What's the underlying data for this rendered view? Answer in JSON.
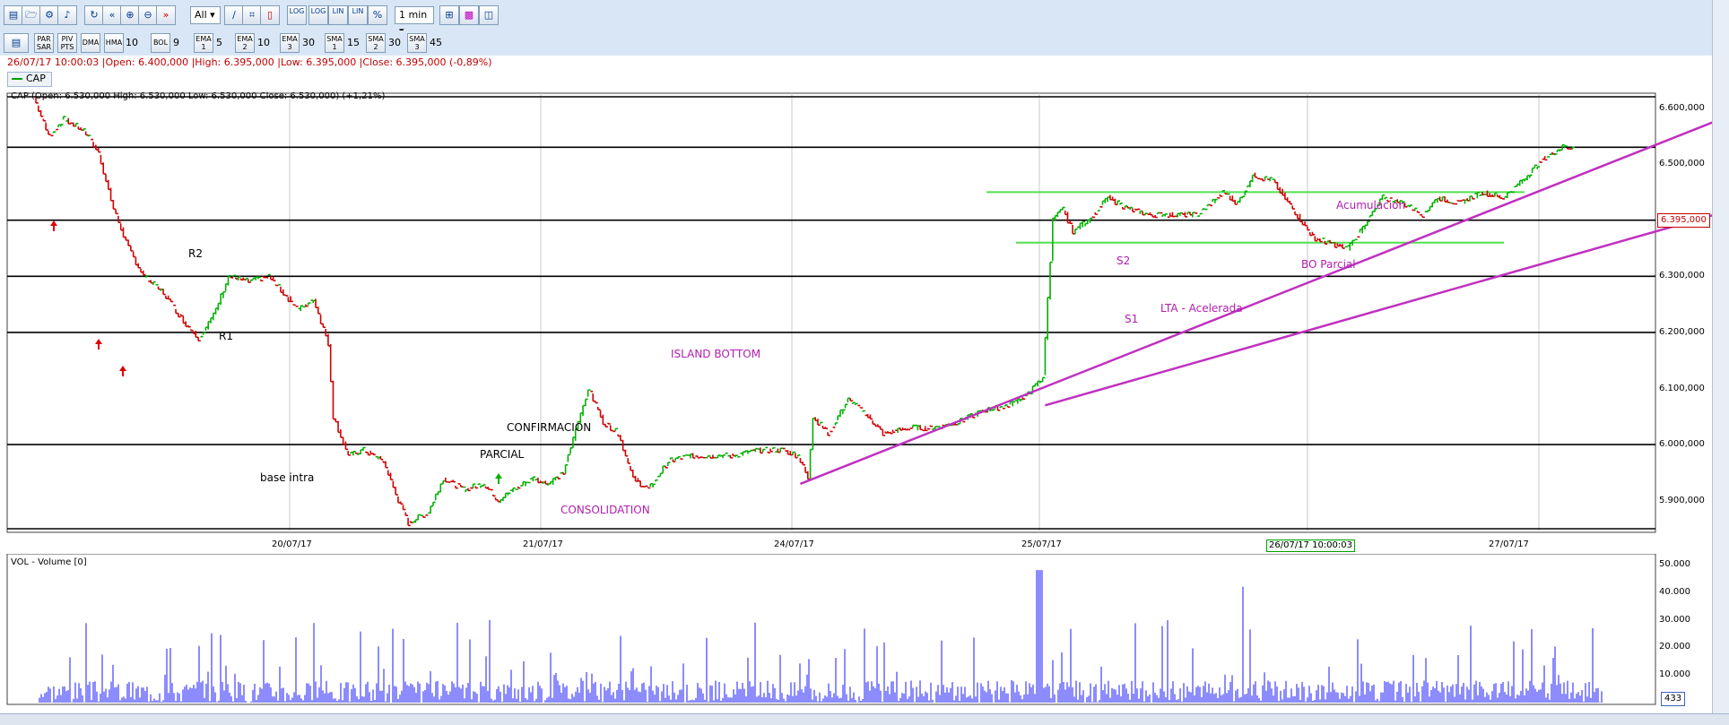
{
  "toolbar": {
    "icons": [
      "new-chart-icon",
      "open-icon",
      "settings-icon",
      "sound-icon",
      "refresh-icon",
      "back-icon",
      "zoom-in-icon",
      "zoom-out-icon",
      "forward-icon"
    ],
    "range_select": "All",
    "chart_mode_icons": [
      "line-chart-icon",
      "bar-chart-icon",
      "candlestick-icon"
    ],
    "scale_buttons": [
      "LOG",
      "LOG",
      "LIN",
      "LIN",
      "%"
    ],
    "interval_select": "1 min",
    "right_icons": [
      "crosshair-icon",
      "color-icon",
      "layout-icon"
    ]
  },
  "indicators": [
    {
      "label": "PAR\nSAR",
      "value": ""
    },
    {
      "label": "PIV\nPTS",
      "value": ""
    },
    {
      "label": "DMA",
      "value": ""
    },
    {
      "label": "HMA",
      "value": "10"
    },
    {
      "label": "BOL",
      "value": "9"
    },
    {
      "label": "EMA\n1",
      "value": "5"
    },
    {
      "label": "EMA\n2",
      "value": "10"
    },
    {
      "label": "EMA\n3",
      "value": "30"
    },
    {
      "label": "SMA\n1",
      "value": "15"
    },
    {
      "label": "SMA\n2",
      "value": "30"
    },
    {
      "label": "SMA\n3",
      "value": "45"
    }
  ],
  "info_bar": "26/07/17 10:00:03 |Open: 6.400,000 |High: 6.395,000 |Low: 6.395,000 |Close: 6.395,000 (-0,89%)",
  "symbol_tab": "CAP",
  "price_legend": "CAP (Open: 6.530,000  High: 6.530,000  Low: 6.530,000  Close: 6.530,000) (+1,21%)",
  "volume_legend": "VOL - Volume [0]",
  "price_axis": [
    "6.600,000",
    "6.500,000",
    "6.400,000",
    "6.300,000",
    "6.200,000",
    "6.100,000",
    "6.000,000",
    "5.900,000"
  ],
  "price_tag": "6.395,000",
  "volume_axis": [
    "50.000",
    "40.000",
    "30.000",
    "20.000",
    "10.000"
  ],
  "volume_tag": "433",
  "dates": [
    "20/07/17",
    "21/07/17",
    "24/07/17",
    "25/07/17",
    "26/07/17 10:00:03",
    "27/07/17"
  ],
  "annotations": {
    "r2": "R2",
    "r1": "R1",
    "base_intra": "base intra",
    "confirmacion": "CONFIRMACION",
    "parcial": "PARCIAL",
    "consolidation": "CONSOLIDATION",
    "island_bottom": "ISLAND BOTTOM",
    "s1": "S1",
    "s2": "S2",
    "lta": "LTA - Acelerada",
    "acumulacion": "Acumulacion",
    "bo_parcial": "BO Parcial"
  },
  "colors": {
    "up": "#00b000",
    "down": "#d00000",
    "trend": "#c030c0",
    "channel": "#50e050",
    "accent": "#c00000"
  },
  "chart_data": {
    "type": "line",
    "ylim": [
      5.85,
      6.62
    ],
    "horizontal_levels": [
      6.62,
      6.53,
      6.4,
      6.3,
      6.2,
      6.0,
      5.85
    ],
    "price_path": [
      [
        0,
        6.62
      ],
      [
        6,
        6.55
      ],
      [
        12,
        6.58
      ],
      [
        20,
        6.56
      ],
      [
        26,
        6.52
      ],
      [
        32,
        6.42
      ],
      [
        38,
        6.35
      ],
      [
        44,
        6.3
      ],
      [
        52,
        6.27
      ],
      [
        60,
        6.22
      ],
      [
        66,
        6.19
      ],
      [
        72,
        6.23
      ],
      [
        78,
        6.3
      ],
      [
        86,
        6.29
      ],
      [
        94,
        6.3
      ],
      [
        100,
        6.27
      ],
      [
        106,
        6.24
      ],
      [
        112,
        6.26
      ],
      [
        118,
        6.18
      ],
      [
        120,
        6.05
      ],
      [
        126,
        5.98
      ],
      [
        132,
        5.99
      ],
      [
        140,
        5.97
      ],
      [
        146,
        5.9
      ],
      [
        150,
        5.86
      ],
      [
        158,
        5.88
      ],
      [
        164,
        5.94
      ],
      [
        172,
        5.92
      ],
      [
        180,
        5.93
      ],
      [
        186,
        5.9
      ],
      [
        192,
        5.92
      ],
      [
        200,
        5.94
      ],
      [
        206,
        5.93
      ],
      [
        212,
        5.95
      ],
      [
        216,
        6.01
      ],
      [
        222,
        6.1
      ],
      [
        228,
        6.04
      ],
      [
        234,
        6.02
      ],
      [
        240,
        5.94
      ],
      [
        246,
        5.92
      ],
      [
        254,
        5.97
      ],
      [
        262,
        5.98
      ],
      [
        270,
        5.98
      ],
      [
        280,
        5.98
      ],
      [
        290,
        5.99
      ],
      [
        300,
        5.99
      ],
      [
        306,
        5.98
      ],
      [
        310,
        5.94
      ],
      [
        312,
        6.05
      ],
      [
        318,
        6.02
      ],
      [
        326,
        6.08
      ],
      [
        334,
        6.05
      ],
      [
        340,
        6.02
      ],
      [
        350,
        6.03
      ],
      [
        360,
        6.03
      ],
      [
        370,
        6.04
      ],
      [
        380,
        6.06
      ],
      [
        390,
        6.07
      ],
      [
        398,
        6.09
      ],
      [
        404,
        6.12
      ],
      [
        408,
        6.4
      ],
      [
        412,
        6.42
      ],
      [
        416,
        6.38
      ],
      [
        422,
        6.4
      ],
      [
        430,
        6.44
      ],
      [
        438,
        6.42
      ],
      [
        446,
        6.41
      ],
      [
        456,
        6.41
      ],
      [
        466,
        6.41
      ],
      [
        476,
        6.45
      ],
      [
        482,
        6.43
      ],
      [
        488,
        6.48
      ],
      [
        496,
        6.47
      ],
      [
        504,
        6.42
      ],
      [
        512,
        6.37
      ],
      [
        518,
        6.36
      ],
      [
        526,
        6.35
      ],
      [
        534,
        6.4
      ],
      [
        540,
        6.44
      ],
      [
        548,
        6.43
      ],
      [
        556,
        6.41
      ],
      [
        562,
        6.44
      ],
      [
        570,
        6.43
      ],
      [
        580,
        6.45
      ],
      [
        588,
        6.44
      ],
      [
        596,
        6.47
      ],
      [
        604,
        6.51
      ],
      [
        612,
        6.53
      ],
      [
        616,
        6.53
      ]
    ],
    "trendlines": [
      {
        "name": "S1",
        "from": [
          306,
          5.93
        ],
        "to": [
          680,
          6.59
        ]
      },
      {
        "name": "LTA - Acelerada",
        "from": [
          404,
          6.07
        ],
        "to": [
          680,
          6.42
        ]
      }
    ]
  }
}
